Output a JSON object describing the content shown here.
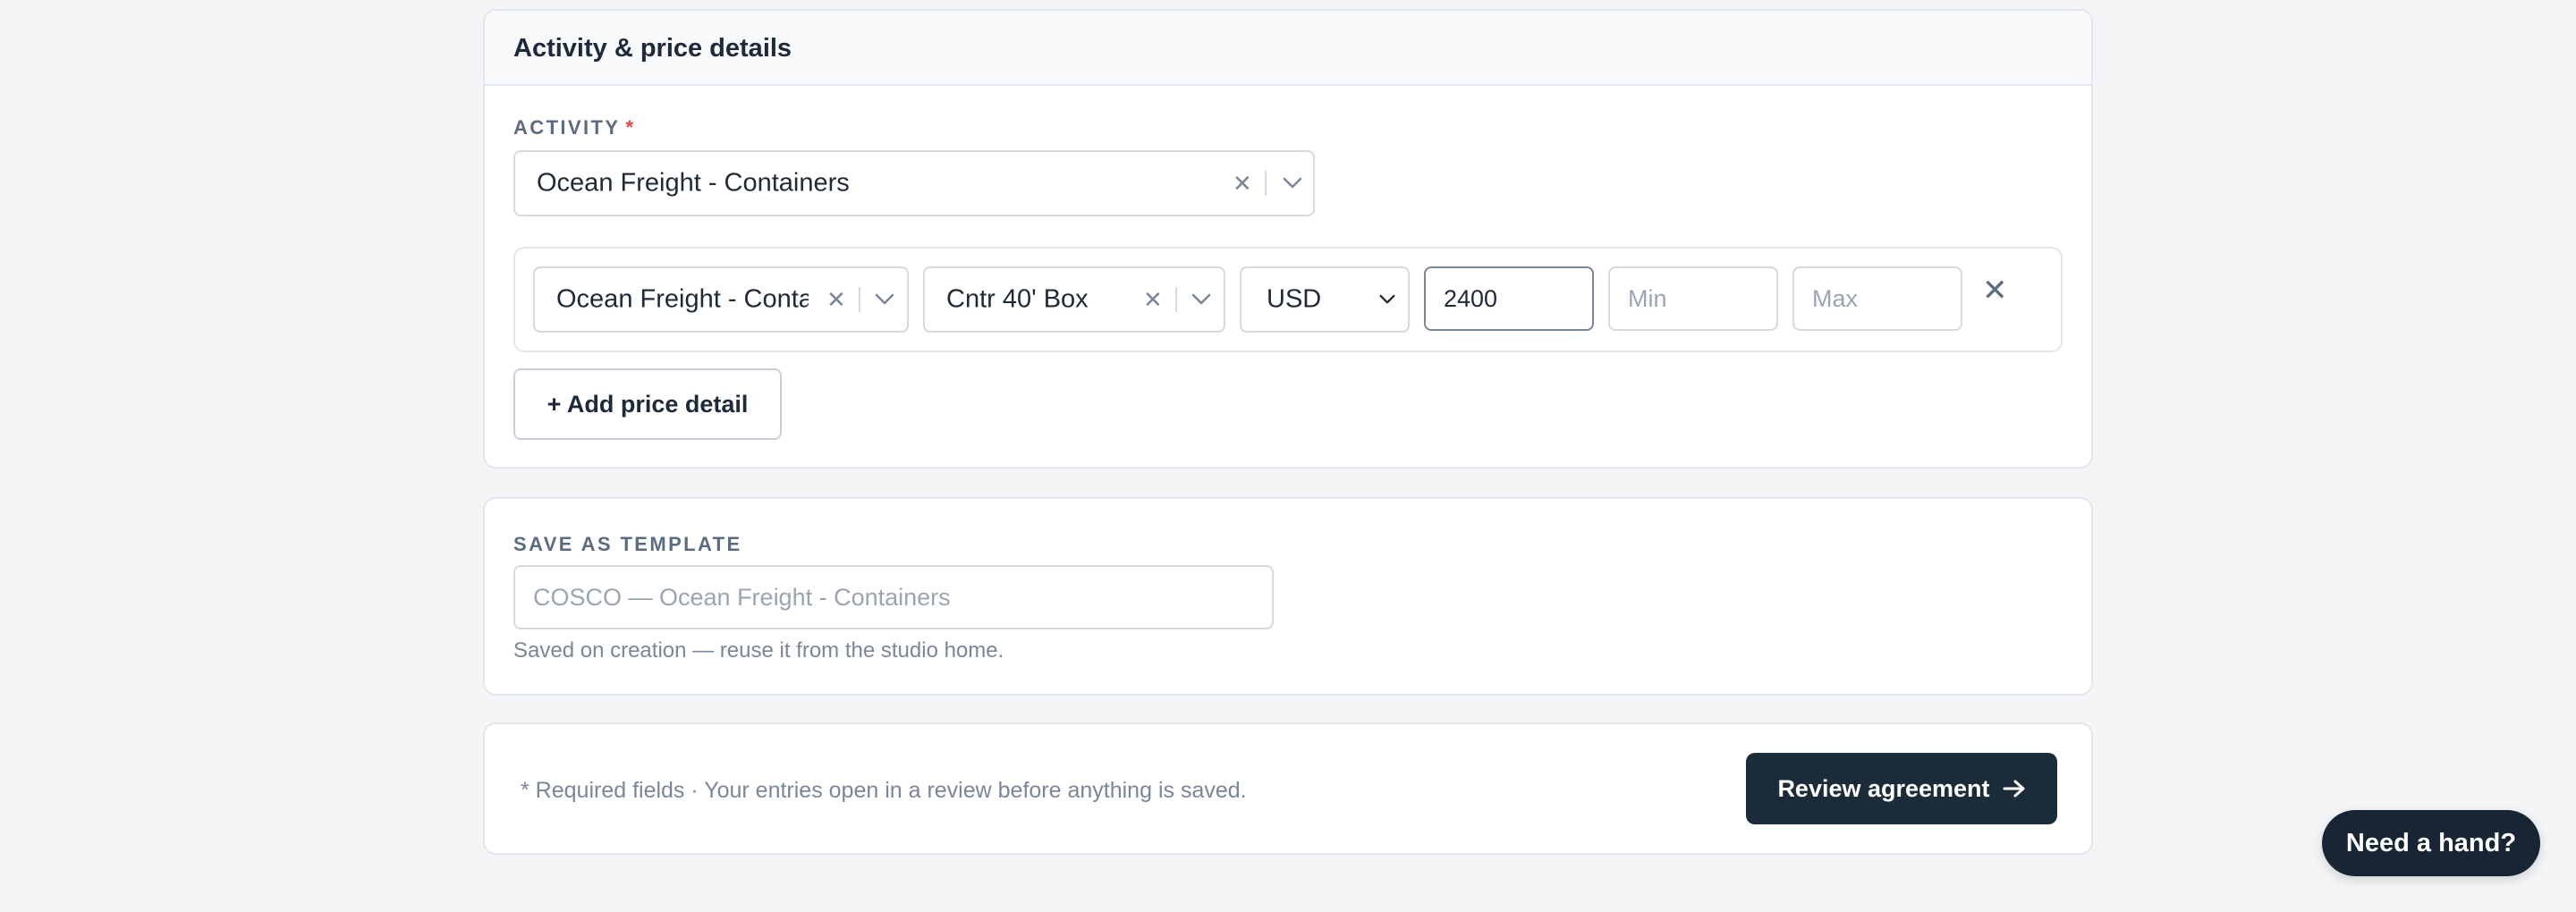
{
  "activity_card": {
    "title": "Activity & price details",
    "activity_label": "ACTIVITY",
    "required_marker": "*",
    "activity_select": {
      "value": "Ocean Freight - Containers"
    },
    "price_row": {
      "activity_value": "Ocean Freight - Containers",
      "container_value": "Cntr 40' Box",
      "currency_value": "USD",
      "currency_options": [
        "USD"
      ],
      "amount_value": "2400",
      "min_placeholder": "Min",
      "max_placeholder": "Max"
    },
    "add_button_label": "+ Add price detail"
  },
  "template_card": {
    "label": "SAVE AS TEMPLATE",
    "input_placeholder": "COSCO — Ocean Freight - Containers",
    "helper": "Saved on creation — reuse it from the studio home."
  },
  "footer": {
    "note": "* Required fields · Your entries open in a review before anything is saved.",
    "review_button_label": "Review agreement"
  },
  "help_button_label": "Need a hand?",
  "icons": {
    "clear": "close-icon",
    "chevron": "chevron-down-icon",
    "remove": "close-icon",
    "arrow": "arrow-right-icon"
  },
  "colors": {
    "primary_dark": "#1c2b3a",
    "required": "#ef4444",
    "muted_text": "#7a8699",
    "border": "#d6dae0"
  }
}
